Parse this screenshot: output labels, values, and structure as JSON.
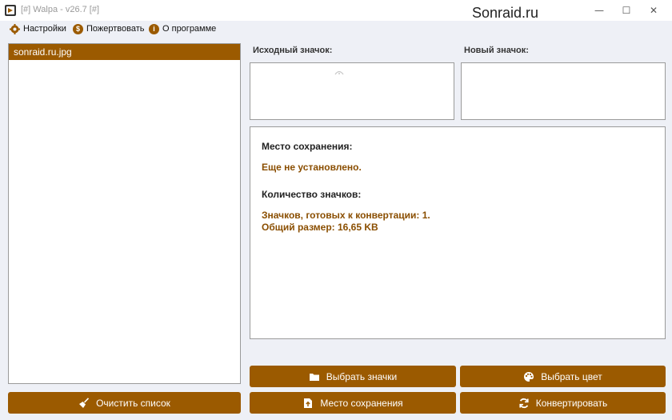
{
  "window": {
    "title": "[#] Walpa - v26.7 [#]",
    "watermark": "Sonraid.ru",
    "minimize": "—",
    "maximize": "☐",
    "close": "✕"
  },
  "menu": {
    "settings": "Настройки",
    "donate": "Пожертвовать",
    "about": "О программе"
  },
  "file_list": {
    "items": [
      "sonraid.ru.jpg"
    ]
  },
  "preview": {
    "source_label": "Исходный значок:",
    "new_label": "Новый значок:"
  },
  "info": {
    "save_location_heading": "Место сохранения:",
    "save_location_value": "Еще не установлено.",
    "count_heading": "Количество значков:",
    "ready_text": "Значков, готовых к конвертации: 1.",
    "total_size_text": "Общий размер: 16,65 KB"
  },
  "buttons": {
    "clear_list": "Очистить список",
    "choose_icons": "Выбрать значки",
    "choose_color": "Выбрать цвет",
    "save_location": "Место сохранения",
    "convert": "Конвертировать"
  },
  "colors": {
    "accent": "#9b5a00",
    "info_value": "#8a4e00",
    "background": "#eef0f6"
  }
}
